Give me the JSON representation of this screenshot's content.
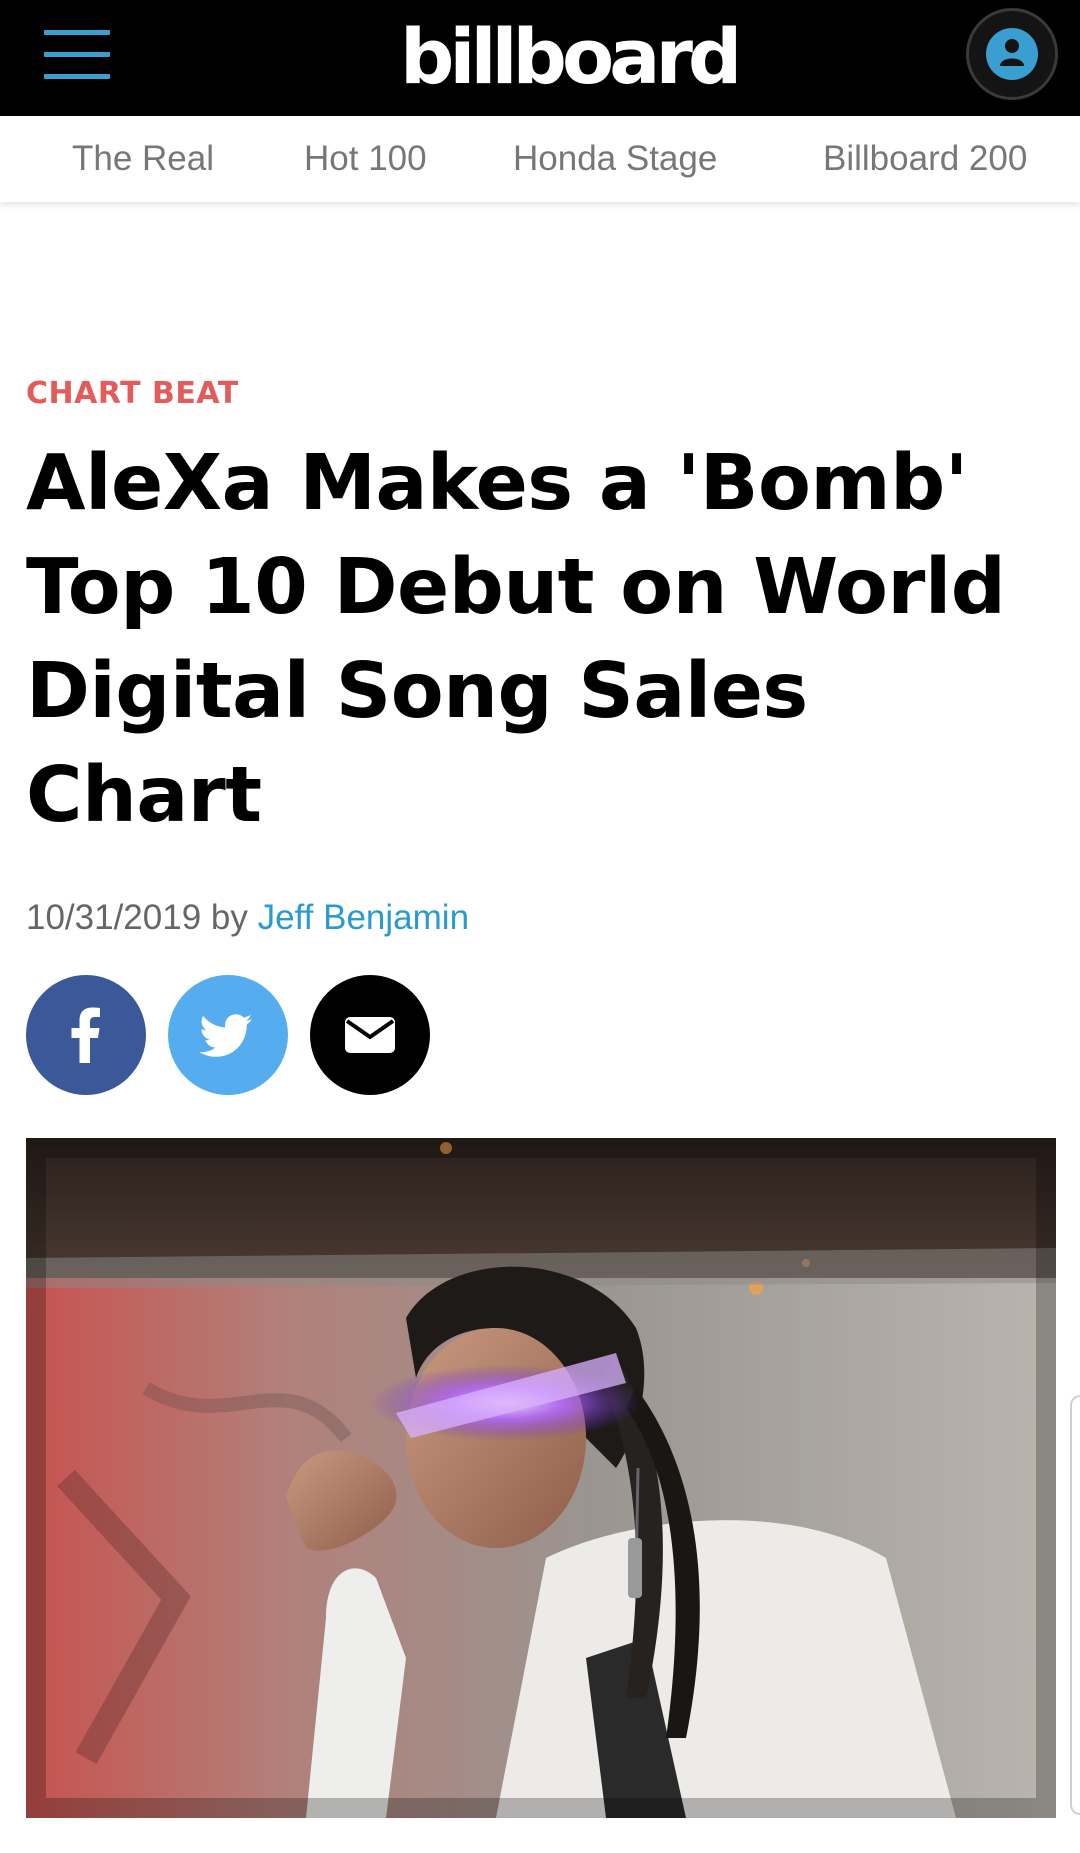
{
  "header": {
    "logo_text": "billboard",
    "menu_icon": "hamburger-menu-icon",
    "account_icon": "user-account-icon",
    "accent_color": "#3a9fd0"
  },
  "nav": {
    "items": [
      {
        "label": "The Real"
      },
      {
        "label": "Hot 100"
      },
      {
        "label": "Honda Stage"
      },
      {
        "label": "Billboard 200"
      }
    ]
  },
  "article": {
    "category": "CHART BEAT",
    "category_color": "#e35b5b",
    "headline": "AleXa Makes a 'Bomb' Top 10 Debut on World Digital Song Sales Chart",
    "date": "10/31/2019",
    "by": "by",
    "author": "Jeff Benjamin",
    "author_color": "#2a9bd0"
  },
  "share": {
    "facebook_icon": "facebook-icon",
    "twitter_icon": "twitter-icon",
    "email_icon": "email-icon",
    "facebook_color": "#3b5998",
    "twitter_color": "#55acee",
    "email_color": "#000000"
  },
  "hero": {
    "image": "photo of performer with braided hair wearing glowing purple LED visor glasses"
  }
}
